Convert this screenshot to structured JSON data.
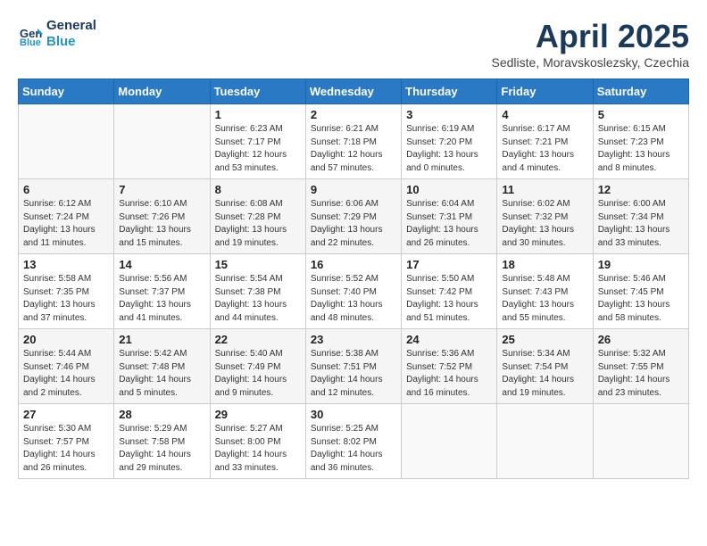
{
  "header": {
    "logo_line1": "General",
    "logo_line2": "Blue",
    "month_title": "April 2025",
    "subtitle": "Sedliste, Moravskoslezsky, Czechia"
  },
  "weekdays": [
    "Sunday",
    "Monday",
    "Tuesday",
    "Wednesday",
    "Thursday",
    "Friday",
    "Saturday"
  ],
  "weeks": [
    [
      {
        "day": "",
        "info": ""
      },
      {
        "day": "",
        "info": ""
      },
      {
        "day": "1",
        "info": "Sunrise: 6:23 AM\nSunset: 7:17 PM\nDaylight: 12 hours and 53 minutes."
      },
      {
        "day": "2",
        "info": "Sunrise: 6:21 AM\nSunset: 7:18 PM\nDaylight: 12 hours and 57 minutes."
      },
      {
        "day": "3",
        "info": "Sunrise: 6:19 AM\nSunset: 7:20 PM\nDaylight: 13 hours and 0 minutes."
      },
      {
        "day": "4",
        "info": "Sunrise: 6:17 AM\nSunset: 7:21 PM\nDaylight: 13 hours and 4 minutes."
      },
      {
        "day": "5",
        "info": "Sunrise: 6:15 AM\nSunset: 7:23 PM\nDaylight: 13 hours and 8 minutes."
      }
    ],
    [
      {
        "day": "6",
        "info": "Sunrise: 6:12 AM\nSunset: 7:24 PM\nDaylight: 13 hours and 11 minutes."
      },
      {
        "day": "7",
        "info": "Sunrise: 6:10 AM\nSunset: 7:26 PM\nDaylight: 13 hours and 15 minutes."
      },
      {
        "day": "8",
        "info": "Sunrise: 6:08 AM\nSunset: 7:28 PM\nDaylight: 13 hours and 19 minutes."
      },
      {
        "day": "9",
        "info": "Sunrise: 6:06 AM\nSunset: 7:29 PM\nDaylight: 13 hours and 22 minutes."
      },
      {
        "day": "10",
        "info": "Sunrise: 6:04 AM\nSunset: 7:31 PM\nDaylight: 13 hours and 26 minutes."
      },
      {
        "day": "11",
        "info": "Sunrise: 6:02 AM\nSunset: 7:32 PM\nDaylight: 13 hours and 30 minutes."
      },
      {
        "day": "12",
        "info": "Sunrise: 6:00 AM\nSunset: 7:34 PM\nDaylight: 13 hours and 33 minutes."
      }
    ],
    [
      {
        "day": "13",
        "info": "Sunrise: 5:58 AM\nSunset: 7:35 PM\nDaylight: 13 hours and 37 minutes."
      },
      {
        "day": "14",
        "info": "Sunrise: 5:56 AM\nSunset: 7:37 PM\nDaylight: 13 hours and 41 minutes."
      },
      {
        "day": "15",
        "info": "Sunrise: 5:54 AM\nSunset: 7:38 PM\nDaylight: 13 hours and 44 minutes."
      },
      {
        "day": "16",
        "info": "Sunrise: 5:52 AM\nSunset: 7:40 PM\nDaylight: 13 hours and 48 minutes."
      },
      {
        "day": "17",
        "info": "Sunrise: 5:50 AM\nSunset: 7:42 PM\nDaylight: 13 hours and 51 minutes."
      },
      {
        "day": "18",
        "info": "Sunrise: 5:48 AM\nSunset: 7:43 PM\nDaylight: 13 hours and 55 minutes."
      },
      {
        "day": "19",
        "info": "Sunrise: 5:46 AM\nSunset: 7:45 PM\nDaylight: 13 hours and 58 minutes."
      }
    ],
    [
      {
        "day": "20",
        "info": "Sunrise: 5:44 AM\nSunset: 7:46 PM\nDaylight: 14 hours and 2 minutes."
      },
      {
        "day": "21",
        "info": "Sunrise: 5:42 AM\nSunset: 7:48 PM\nDaylight: 14 hours and 5 minutes."
      },
      {
        "day": "22",
        "info": "Sunrise: 5:40 AM\nSunset: 7:49 PM\nDaylight: 14 hours and 9 minutes."
      },
      {
        "day": "23",
        "info": "Sunrise: 5:38 AM\nSunset: 7:51 PM\nDaylight: 14 hours and 12 minutes."
      },
      {
        "day": "24",
        "info": "Sunrise: 5:36 AM\nSunset: 7:52 PM\nDaylight: 14 hours and 16 minutes."
      },
      {
        "day": "25",
        "info": "Sunrise: 5:34 AM\nSunset: 7:54 PM\nDaylight: 14 hours and 19 minutes."
      },
      {
        "day": "26",
        "info": "Sunrise: 5:32 AM\nSunset: 7:55 PM\nDaylight: 14 hours and 23 minutes."
      }
    ],
    [
      {
        "day": "27",
        "info": "Sunrise: 5:30 AM\nSunset: 7:57 PM\nDaylight: 14 hours and 26 minutes."
      },
      {
        "day": "28",
        "info": "Sunrise: 5:29 AM\nSunset: 7:58 PM\nDaylight: 14 hours and 29 minutes."
      },
      {
        "day": "29",
        "info": "Sunrise: 5:27 AM\nSunset: 8:00 PM\nDaylight: 14 hours and 33 minutes."
      },
      {
        "day": "30",
        "info": "Sunrise: 5:25 AM\nSunset: 8:02 PM\nDaylight: 14 hours and 36 minutes."
      },
      {
        "day": "",
        "info": ""
      },
      {
        "day": "",
        "info": ""
      },
      {
        "day": "",
        "info": ""
      }
    ]
  ]
}
